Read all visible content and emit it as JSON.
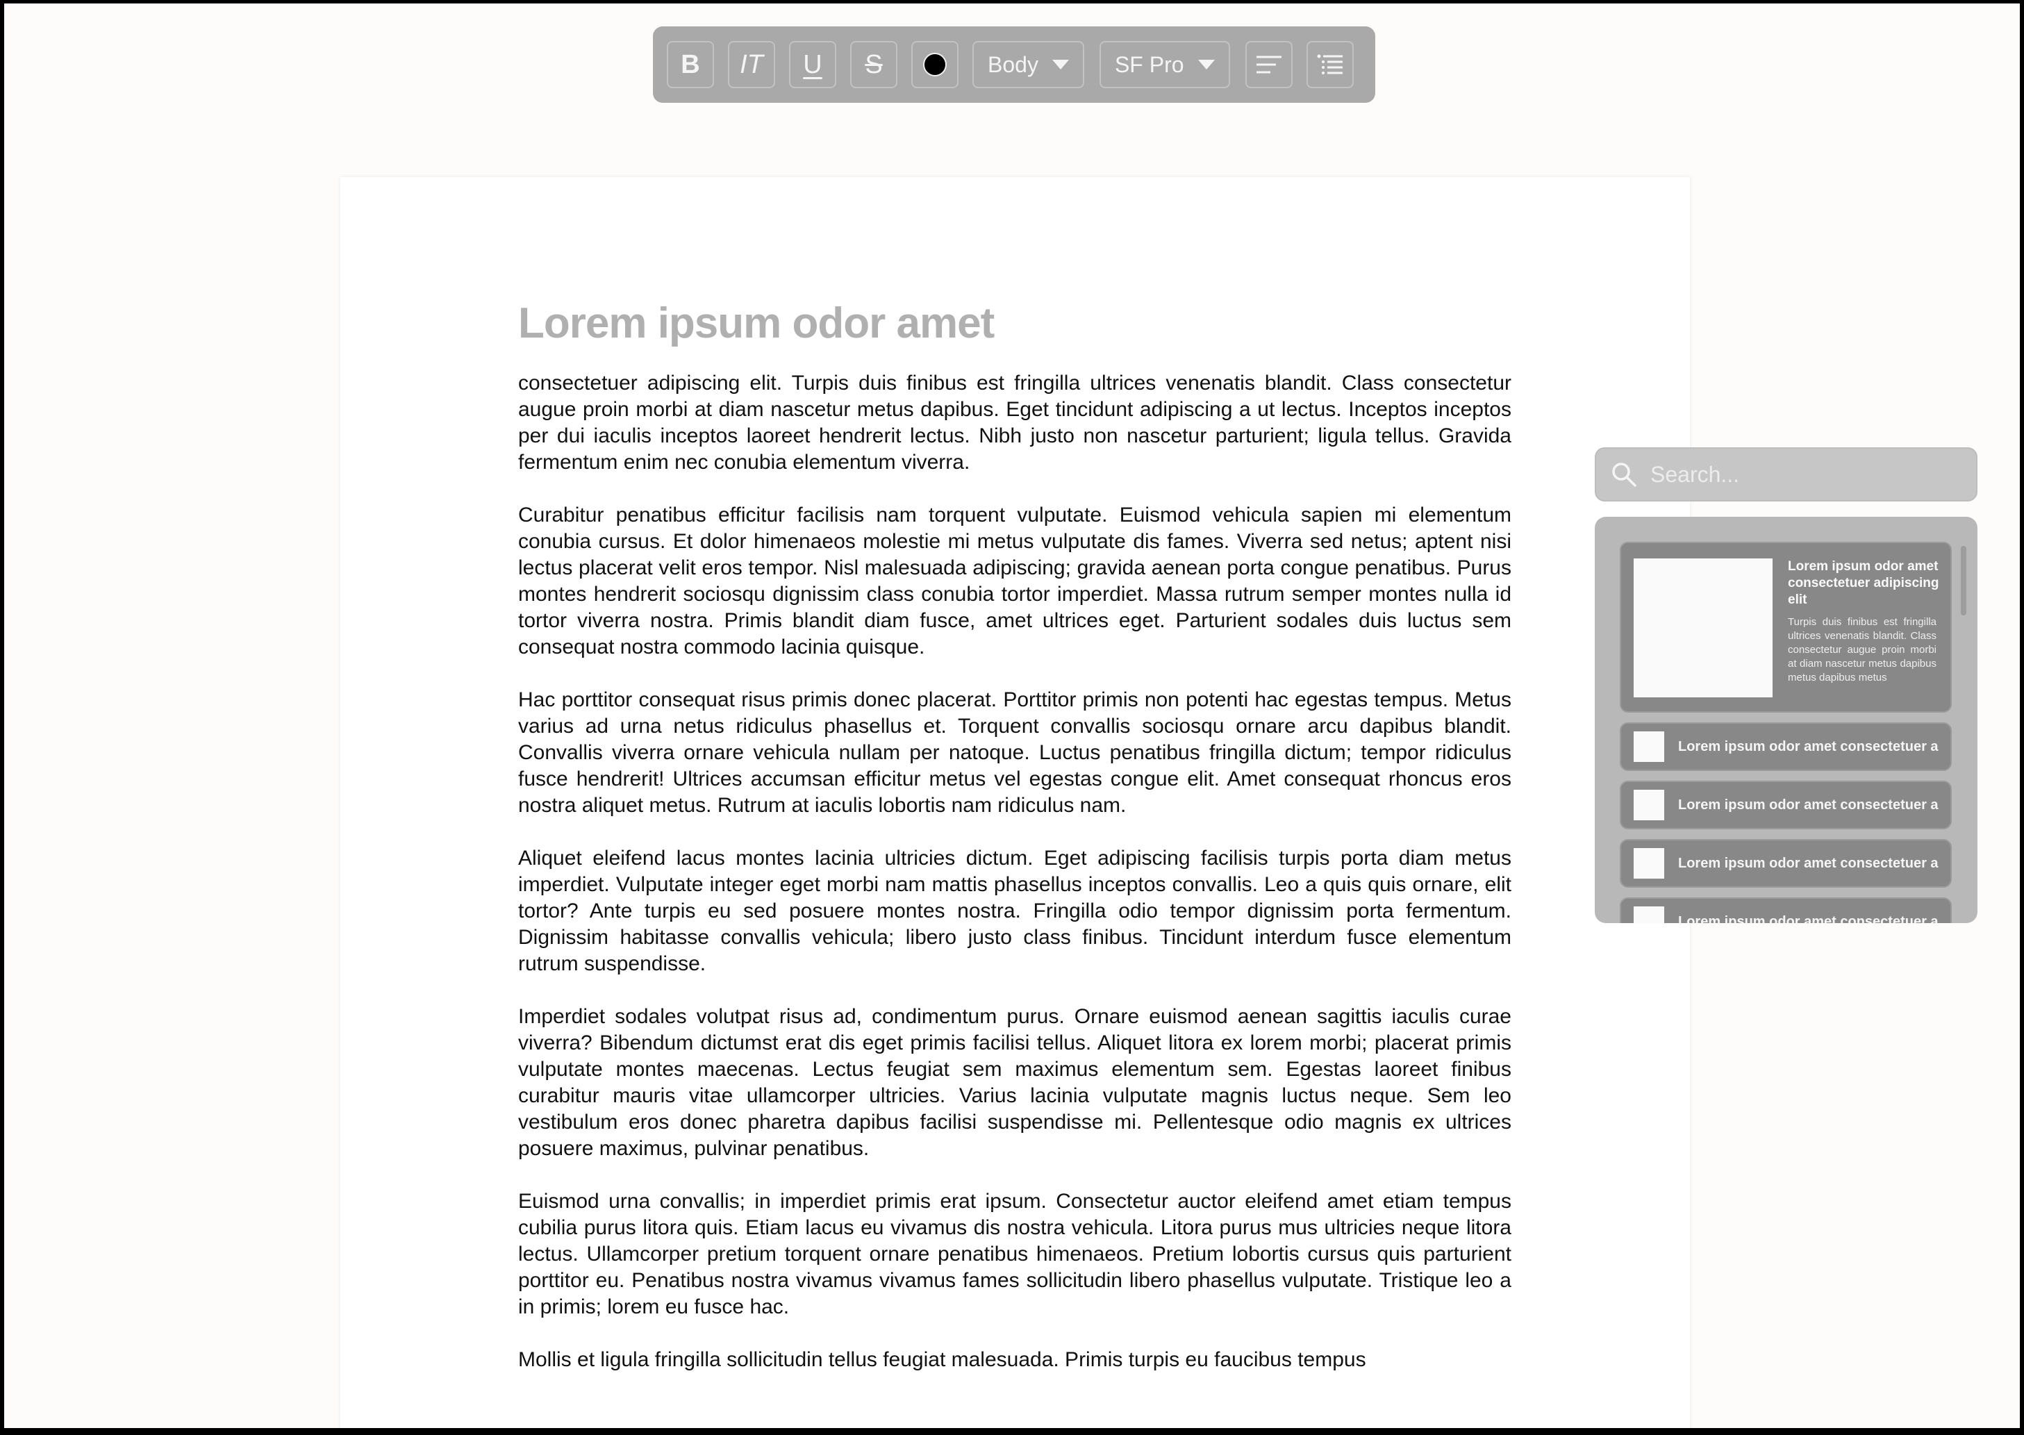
{
  "toolbar": {
    "bold_label": "B",
    "italic_label": "IT",
    "underline_label": "U",
    "strike_label": "S",
    "text_color": "#000000",
    "style_dropdown": "Body",
    "font_dropdown": "SF Pro"
  },
  "document": {
    "title": "Lorem ipsum odor amet",
    "paragraphs": [
      "consectetuer adipiscing elit. Turpis duis finibus est fringilla ultrices venenatis blandit. Class consectetur augue proin morbi at diam nascetur metus dapibus. Eget tincidunt adipiscing a ut lectus. Inceptos inceptos per dui iaculis inceptos laoreet hendrerit lectus. Nibh justo non nascetur parturient; ligula tellus. Gravida fermentum enim nec conubia elementum viverra.",
      "Curabitur penatibus efficitur facilisis nam torquent vulputate. Euismod vehicula sapien mi elementum conubia cursus. Et dolor himenaeos molestie mi metus vulputate dis fames. Viverra sed netus; aptent nisi lectus placerat velit eros tempor. Nisl malesuada adipiscing; gravida aenean porta congue penatibus. Purus montes hendrerit sociosqu dignissim class conubia tortor imperdiet. Massa rutrum semper montes nulla id tortor viverra nostra. Primis blandit diam fusce, amet ultrices eget. Parturient sodales duis luctus sem consequat nostra commodo lacinia quisque.",
      "Hac porttitor consequat risus primis donec placerat. Porttitor primis non potenti hac egestas tempus. Metus varius ad urna netus ridiculus phasellus et. Torquent convallis sociosqu ornare arcu dapibus blandit. Convallis viverra ornare vehicula nullam per natoque. Luctus penatibus fringilla dictum; tempor ridiculus fusce hendrerit! Ultrices accumsan efficitur metus vel egestas congue elit. Amet consequat rhoncus eros nostra aliquet metus. Rutrum at iaculis lobortis nam ridiculus nam.",
      "Aliquet eleifend lacus montes lacinia ultricies dictum. Eget adipiscing facilisis turpis porta diam metus imperdiet. Vulputate integer eget morbi nam mattis phasellus inceptos convallis. Leo a quis quis ornare, elit tortor? Ante turpis eu sed posuere montes nostra. Fringilla odio tempor dignissim porta fermentum. Dignissim habitasse convallis vehicula; libero justo class finibus. Tincidunt interdum fusce elementum rutrum suspendisse.",
      "Imperdiet sodales volutpat risus ad, condimentum purus. Ornare euismod aenean sagittis iaculis curae viverra? Bibendum dictumst erat dis eget primis facilisi tellus. Aliquet litora ex lorem morbi; placerat primis vulputate montes maecenas. Lectus feugiat sem maximus elementum sem. Egestas laoreet finibus curabitur mauris vitae ullamcorper ultricies. Varius lacinia vulputate magnis luctus neque. Sem leo vestibulum eros donec pharetra dapibus facilisi suspendisse mi. Pellentesque odio magnis ex ultrices posuere maximus, pulvinar penatibus.",
      "Euismod urna convallis; in imperdiet primis erat ipsum. Consectetur auctor eleifend amet etiam tempus cubilia purus litora quis. Etiam lacus eu vivamus dis nostra vehicula. Litora purus mus ultricies neque litora lectus. Ullamcorper pretium torquent ornare penatibus himenaeos. Pretium lobortis cursus quis parturient porttitor eu. Penatibus nostra vivamus vivamus fames sollicitudin libero phasellus vulputate. Tristique leo a in primis; lorem eu fusce hac.",
      "Mollis et ligula fringilla sollicitudin tellus feugiat malesuada. Primis turpis eu faucibus tempus"
    ]
  },
  "search": {
    "placeholder": "Search...",
    "featured": {
      "title": "Lorem ipsum odor amet consectetuer adipiscing elit",
      "body": "Turpis duis finibus est fringilla ultrices venenatis blandit. Class consectetur augue proin morbi at diam nascetur metus dapibus metus dapibus metus"
    },
    "results": [
      {
        "label": "Lorem ipsum odor amet consectetuer a"
      },
      {
        "label": "Lorem ipsum odor amet consectetuer a"
      },
      {
        "label": "Lorem ipsum odor amet consectetuer a"
      },
      {
        "label": "Lorem ipsum odor amet consectetuer a"
      }
    ]
  }
}
